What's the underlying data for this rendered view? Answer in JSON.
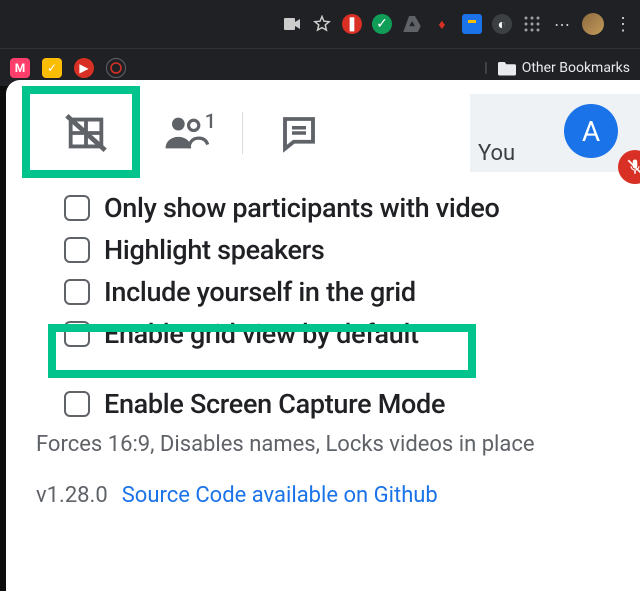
{
  "chrome": {
    "bookmarks_label": "Other Bookmarks"
  },
  "toolbar": {
    "people_count": "1",
    "you_label": "You",
    "avatar_initial": "A"
  },
  "options": {
    "only_video": "Only show participants with video",
    "highlight_speakers": "Highlight speakers",
    "include_self": "Include yourself in the grid",
    "enable_default": "Enable grid view by default",
    "screen_capture": "Enable Screen Capture Mode",
    "screen_capture_help": "Forces 16:9, Disables names, Locks videos in place"
  },
  "footer": {
    "version": "v1.28.0",
    "link_text": "Source Code available on Github"
  }
}
